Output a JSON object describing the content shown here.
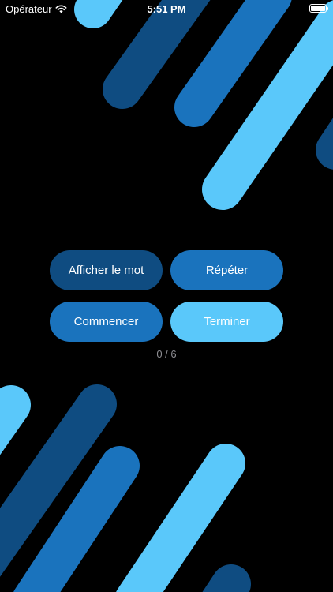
{
  "status_bar": {
    "carrier": "Opérateur",
    "time": "5:51 PM",
    "wifi_icon": "wifi-icon",
    "battery_icon": "battery-icon",
    "battery_level": 1.0
  },
  "colors": {
    "background": "#000000",
    "dark_blue": "#0f4c81",
    "mid_blue": "#1a73bd",
    "light_blue": "#5ac8fa"
  },
  "buttons": {
    "show_word": "Afficher le mot",
    "repeat": "Répéter",
    "start": "Commencer",
    "finish": "Terminer"
  },
  "progress": {
    "text": "0 / 6",
    "current": 0,
    "total": 6
  }
}
